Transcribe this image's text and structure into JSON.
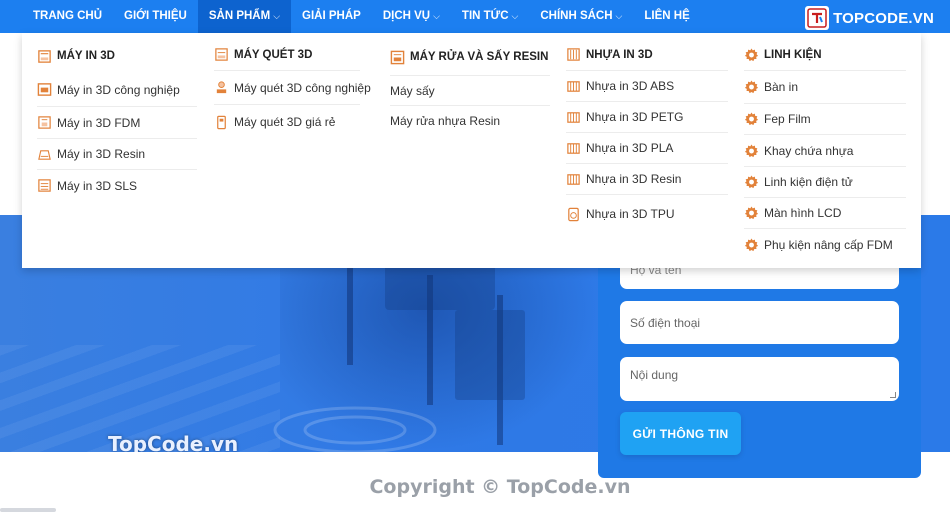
{
  "nav": {
    "items": [
      {
        "label": "TRANG CHỦ",
        "dropdown": false,
        "active": false
      },
      {
        "label": "GIỚI THIỆU",
        "dropdown": false,
        "active": false
      },
      {
        "label": "SẢN PHẨM",
        "dropdown": true,
        "active": true
      },
      {
        "label": "GIẢI PHÁP",
        "dropdown": false,
        "active": false
      },
      {
        "label": "DỊCH VỤ",
        "dropdown": true,
        "active": false
      },
      {
        "label": "TIN TỨC",
        "dropdown": true,
        "active": false
      },
      {
        "label": "CHÍNH SÁCH",
        "dropdown": true,
        "active": false
      },
      {
        "label": "LIÊN HỆ",
        "dropdown": false,
        "active": false
      }
    ],
    "dropdown_glyph": "⌵"
  },
  "brand": {
    "name": "TOPCODE.VN"
  },
  "mega_menu": {
    "columns": [
      {
        "heading": "MÁY IN 3D",
        "icon": "printer-icon",
        "items": [
          {
            "label": "Máy in 3D công nghiệp",
            "icon": "industrial-printer-icon"
          },
          {
            "label": "Máy in 3D FDM",
            "icon": "fdm-printer-icon"
          },
          {
            "label": "Máy in 3D Resin",
            "icon": "resin-printer-icon"
          },
          {
            "label": "Máy in 3D SLS",
            "icon": "sls-printer-icon"
          }
        ]
      },
      {
        "heading": "MÁY QUÉT 3D",
        "icon": "scanner-icon",
        "items": [
          {
            "label": "Máy quét 3D công nghiệp",
            "icon": "industrial-scanner-icon"
          },
          {
            "label": "Máy quét 3D giá rẻ",
            "icon": "handheld-scanner-icon"
          }
        ]
      },
      {
        "heading": "MÁY RỬA VÀ SẤY RESIN",
        "icon": "wash-cure-icon",
        "items": [
          {
            "label": "Máy sấy",
            "icon": ""
          },
          {
            "label": "Máy rửa nhựa Resin",
            "icon": ""
          }
        ]
      },
      {
        "heading": "NHỰA IN 3D",
        "icon": "filament-icon",
        "items": [
          {
            "label": "Nhựa in 3D ABS",
            "icon": "filament-spool-icon"
          },
          {
            "label": "Nhựa in 3D PETG",
            "icon": "filament-spool-icon"
          },
          {
            "label": "Nhựa in 3D PLA",
            "icon": "filament-spool-icon"
          },
          {
            "label": "Nhựa in 3D Resin",
            "icon": "filament-spool-icon"
          },
          {
            "label": "Nhựa in 3D TPU",
            "icon": "resin-bottle-icon"
          }
        ]
      },
      {
        "heading": "LINH KIỆN",
        "icon": "gear-icon",
        "items": [
          {
            "label": "Bàn in",
            "icon": "gear-icon"
          },
          {
            "label": "Fep Film",
            "icon": "gear-icon"
          },
          {
            "label": "Khay chứa nhựa",
            "icon": "gear-icon"
          },
          {
            "label": "Linh kiện điện tử",
            "icon": "gear-icon"
          },
          {
            "label": "Màn hình LCD",
            "icon": "gear-icon"
          },
          {
            "label": "Phụ kiện nâng cấp FDM",
            "icon": "gear-icon"
          }
        ]
      }
    ]
  },
  "contact_form": {
    "name_placeholder": "Họ và tên",
    "phone_placeholder": "Số điện thoại",
    "message_placeholder": "Nội dung",
    "submit_label": "GỬI THÔNG TIN"
  },
  "watermarks": {
    "hero": "TopCode.vn",
    "footer": "Copyright © TopCode.vn"
  },
  "colors": {
    "nav_bg": "#1c7ff0",
    "nav_active": "#0d63cf",
    "hero_bg": "#2f79e6",
    "form_bg": "#1f79e6",
    "submit_bg": "#1fa2f3",
    "icon_accent": "#e2823a"
  }
}
